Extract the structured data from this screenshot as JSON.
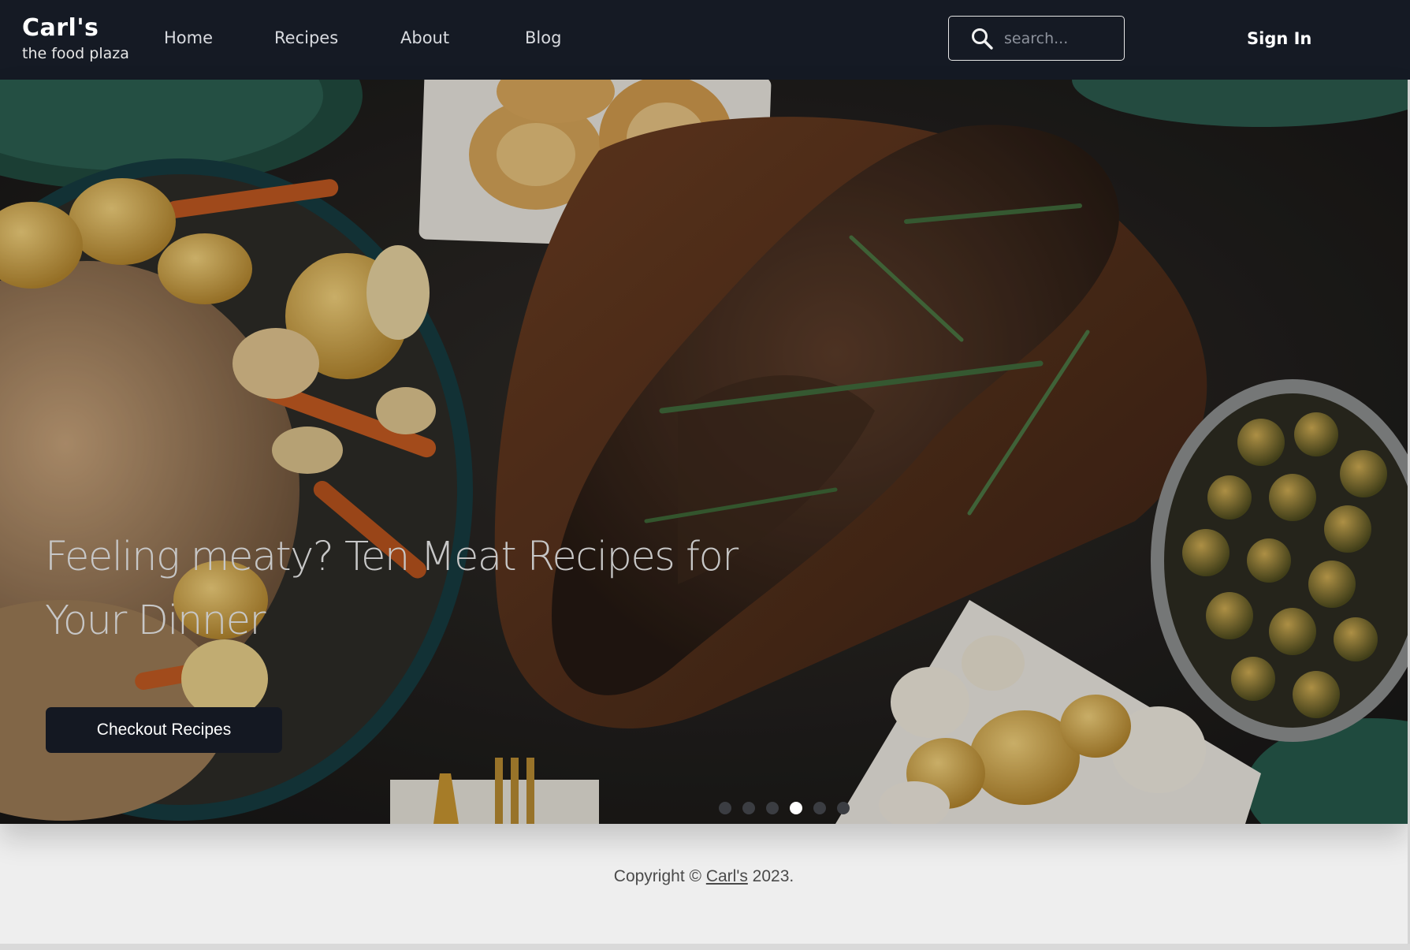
{
  "brand": {
    "name": "Carl's",
    "tagline": "the food plaza"
  },
  "nav": {
    "links": [
      {
        "label": "Home"
      },
      {
        "label": "Recipes"
      },
      {
        "label": "About"
      },
      {
        "label": "Blog"
      }
    ],
    "signin_label": "Sign In"
  },
  "search": {
    "placeholder": "search...",
    "value": "",
    "icon": "search-icon"
  },
  "hero": {
    "title": "Feeling meaty? Ten Meat Recipes for Your Dinner",
    "cta_label": "Checkout Recipes",
    "slide_count": 6,
    "active_slide": 4
  },
  "footer": {
    "prefix": "Copyright © ",
    "link_label": "Carl's",
    "suffix": " 2023."
  },
  "colors": {
    "header_bg": "#151a24",
    "accent_button": "#141822",
    "page_bg": "#eeeeee"
  }
}
